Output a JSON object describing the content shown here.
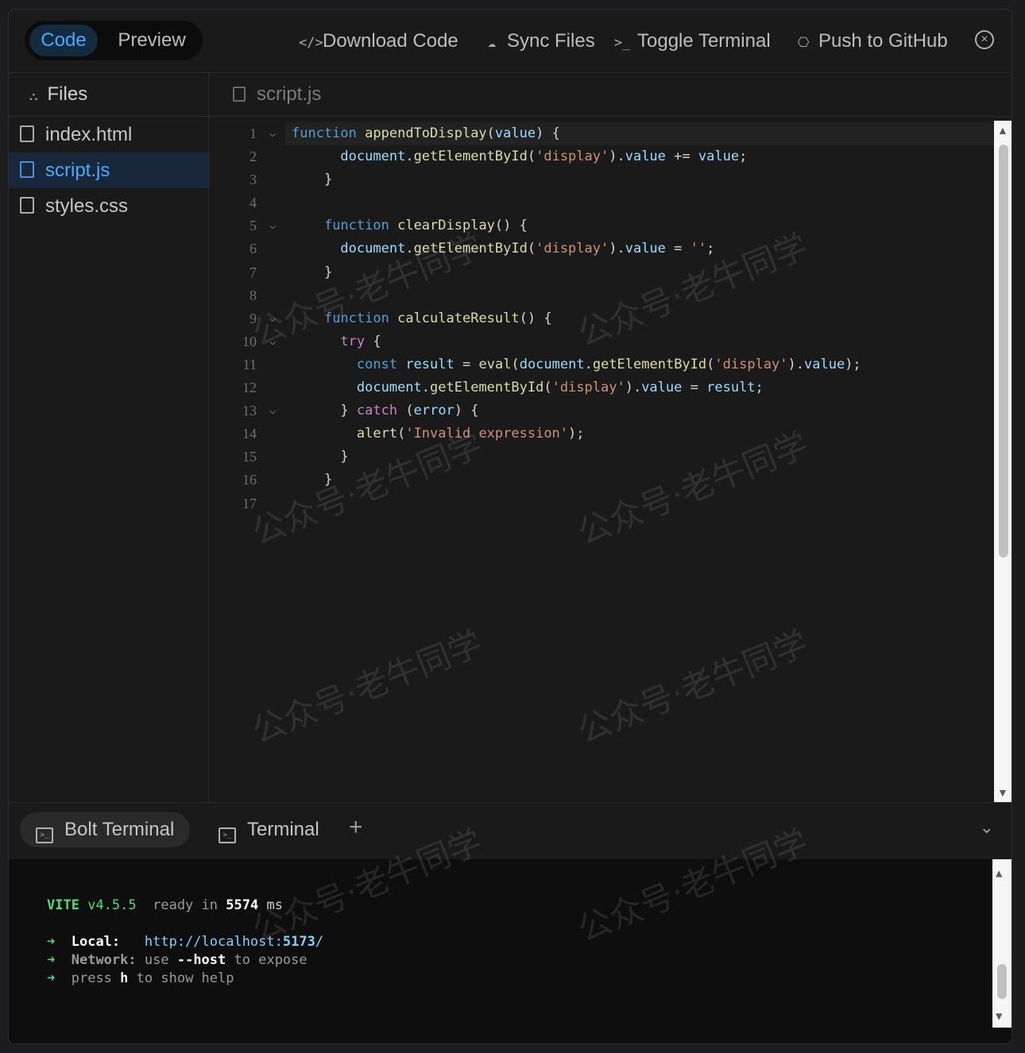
{
  "header": {
    "view_toggle": {
      "code": "Code",
      "preview": "Preview",
      "active": "Code"
    },
    "actions": [
      {
        "label": "Download Code",
        "icon": "code-icon"
      },
      {
        "label": "Sync Files",
        "icon": "cloud-sync-icon"
      },
      {
        "label": "Toggle Terminal",
        "icon": "terminal-prompt-icon"
      },
      {
        "label": "Push to GitHub",
        "icon": "github-icon"
      }
    ],
    "close_icon": "close-circle-icon"
  },
  "sidebar": {
    "title": "Files",
    "files": [
      {
        "name": "index.html",
        "active": false
      },
      {
        "name": "script.js",
        "active": true
      },
      {
        "name": "styles.css",
        "active": false
      }
    ]
  },
  "editor": {
    "tab": "script.js",
    "line_numbers": [
      "1",
      "2",
      "3",
      "4",
      "5",
      "6",
      "7",
      "8",
      "9",
      "10",
      "11",
      "12",
      "13",
      "14",
      "15",
      "16",
      "17"
    ]
  },
  "terminal": {
    "tabs": [
      "Bolt Terminal",
      "Terminal"
    ],
    "vite_label": "VITE",
    "vite_version": "v4.5.5",
    "ready_text": "ready in",
    "ready_ms": "5574",
    "ms": "ms",
    "arrow": "➜",
    "local_label": "Local:",
    "local_url_prefix": "http://localhost:",
    "local_port": "5173",
    "local_url_suffix": "/",
    "network_label": "Network:",
    "network_use": "use",
    "network_flag": "--host",
    "network_rest": "to expose",
    "press": "press",
    "press_key": "h",
    "press_rest": "to show help"
  },
  "watermark": "公众号·老牛同学",
  "colors": {
    "accent": "#4ba7ff",
    "keyword": "#569cd6",
    "function": "#dcdcaa",
    "variable": "#9cdcfe",
    "string": "#ce9178",
    "control": "#c586c0",
    "terminal_green": "#4ade80"
  }
}
